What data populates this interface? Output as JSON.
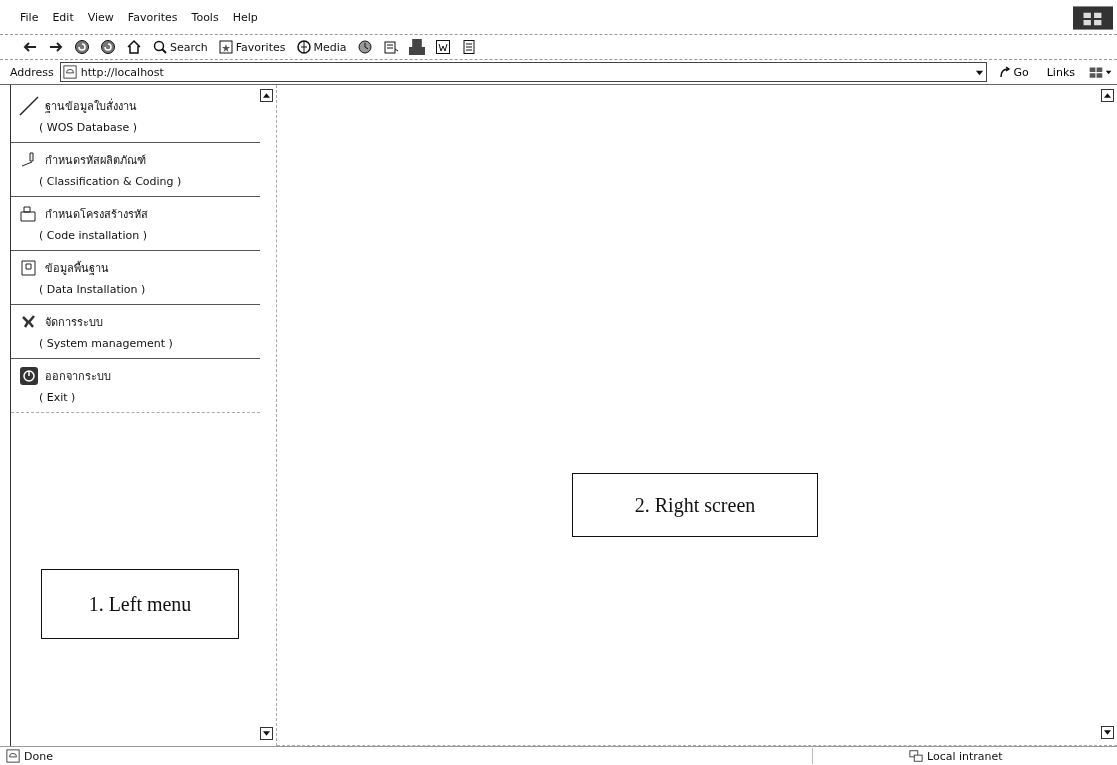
{
  "menu_bar": [
    "File",
    "Edit",
    "View",
    "Favorites",
    "Tools",
    "Help"
  ],
  "toolbar": {
    "buttons": [
      {
        "kind": "back"
      },
      {
        "kind": "forward"
      },
      {
        "kind": "stop"
      },
      {
        "kind": "refresh"
      },
      {
        "kind": "home"
      },
      {
        "kind": "search",
        "label": "Search"
      },
      {
        "kind": "favorites",
        "label": "Favorites"
      },
      {
        "kind": "media",
        "label": "Media"
      },
      {
        "kind": "history"
      },
      {
        "kind": "mail"
      },
      {
        "kind": "print"
      },
      {
        "kind": "edit"
      },
      {
        "kind": "discuss"
      }
    ]
  },
  "address_bar": {
    "label": "Address",
    "value": "http://localhost",
    "go": "Go",
    "links": "Links"
  },
  "left_menu": {
    "items": [
      {
        "title": "ฐานข้อมูลใบสั่งงาน",
        "subtitle": "( WOS Database )"
      },
      {
        "title": "กำหนดรหัสผลิตภัณฑ์",
        "subtitle": "( Classification & Coding )"
      },
      {
        "title": "กำหนดโครงสร้างรหัส",
        "subtitle": "( Code installation )"
      },
      {
        "title": "ข้อมูลพื้นฐาน",
        "subtitle": "( Data Installation )"
      },
      {
        "title": "จัดการระบบ",
        "subtitle": "( System management )"
      },
      {
        "title": "ออกจากระบบ",
        "subtitle": "( Exit )"
      }
    ]
  },
  "annotations": {
    "left": "1. Left menu",
    "right": "2. Right screen"
  },
  "status_bar": {
    "status": "Done",
    "zone": "Local intranet"
  }
}
